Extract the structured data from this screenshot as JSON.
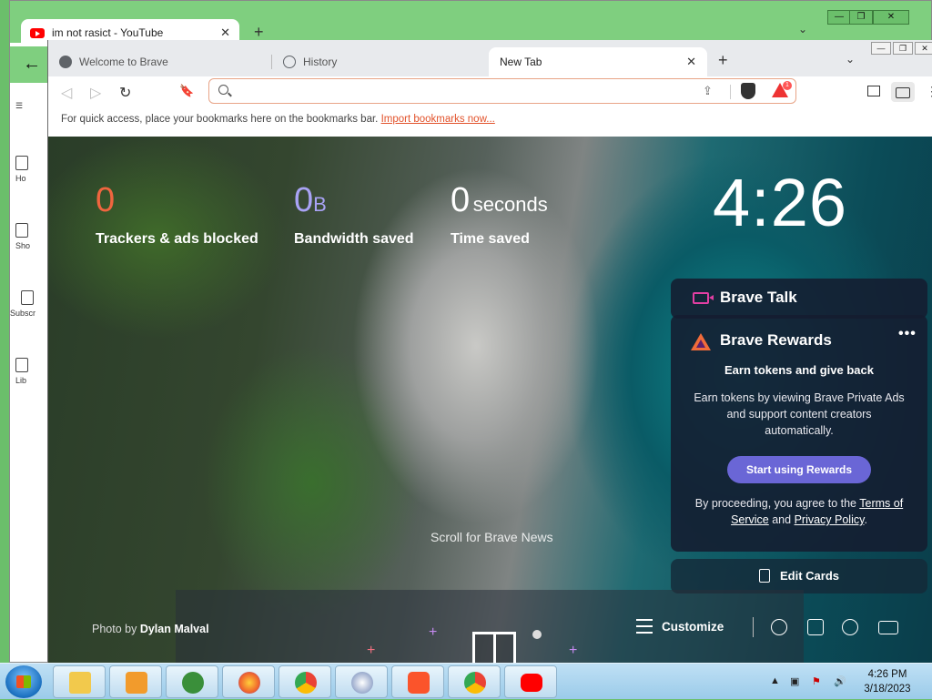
{
  "background_window": {
    "tab_title": "im not rasict - YouTube",
    "tab_close": "✕",
    "new_tab": "+",
    "chevron": "⌄",
    "controls": [
      "—",
      "❐",
      "✕"
    ],
    "back_arrow": "←",
    "sidebar": [
      "Ho",
      "Sho",
      "Subscr",
      "Lib"
    ]
  },
  "browser": {
    "tabs": [
      {
        "label": "Welcome to Brave",
        "icon": "brave-lion-icon"
      },
      {
        "label": "History",
        "icon": "history-icon"
      },
      {
        "label": "New Tab",
        "icon": "",
        "active": true
      }
    ],
    "tab_close": "✕",
    "new_tab": "+",
    "chevron": "⌄",
    "window_controls": [
      "—",
      "❐",
      "✕"
    ],
    "nav": {
      "back": "◁",
      "forward": "▷",
      "reload": "↻",
      "bookmark": "🔖",
      "share": "⇪",
      "menu": "⋮"
    },
    "omnibox": {
      "value": "",
      "placeholder": ""
    },
    "rewards_badge": "1",
    "bookmarks_bar": {
      "text": "For quick access, place your bookmarks here on the bookmarks bar.",
      "link": "Import bookmarks now..."
    }
  },
  "ntp": {
    "stats": [
      {
        "value": "0",
        "unit": "",
        "label": "Trackers & ads blocked",
        "color": "#f0653f"
      },
      {
        "value": "0",
        "unit": "B",
        "label": "Bandwidth saved",
        "color": "#a9a3f5"
      },
      {
        "value": "0",
        "unit": "seconds",
        "label": "Time saved",
        "color": "#ffffff"
      }
    ],
    "clock": "4:26",
    "brave_talk": {
      "title": "Brave Talk"
    },
    "brave_rewards": {
      "title": "Brave Rewards",
      "more": "•••",
      "subtitle": "Earn tokens and give back",
      "description": "Earn tokens by viewing Brave Private Ads and support content creators automatically.",
      "cta": "Start using Rewards",
      "terms_prefix": "By proceeding, you agree to the ",
      "terms_link": "Terms of Service",
      "terms_and": " and ",
      "privacy_link": "Privacy Policy",
      "terms_suffix": "."
    },
    "edit_cards": "Edit Cards",
    "scroll_news": "Scroll for Brave News",
    "photo_credit_prefix": "Photo by ",
    "photo_credit_name": "Dylan Malval",
    "customize": "Customize"
  },
  "taskbar": {
    "apps": [
      "file-explorer-icon",
      "media-player-icon",
      "intel-graphics-icon",
      "firefox-icon",
      "chrome-intel-icon",
      "paint-icon",
      "brave-icon",
      "chrome-b-icon",
      "youtube-icon"
    ],
    "time": "4:26 PM",
    "date": "3/18/2023"
  }
}
